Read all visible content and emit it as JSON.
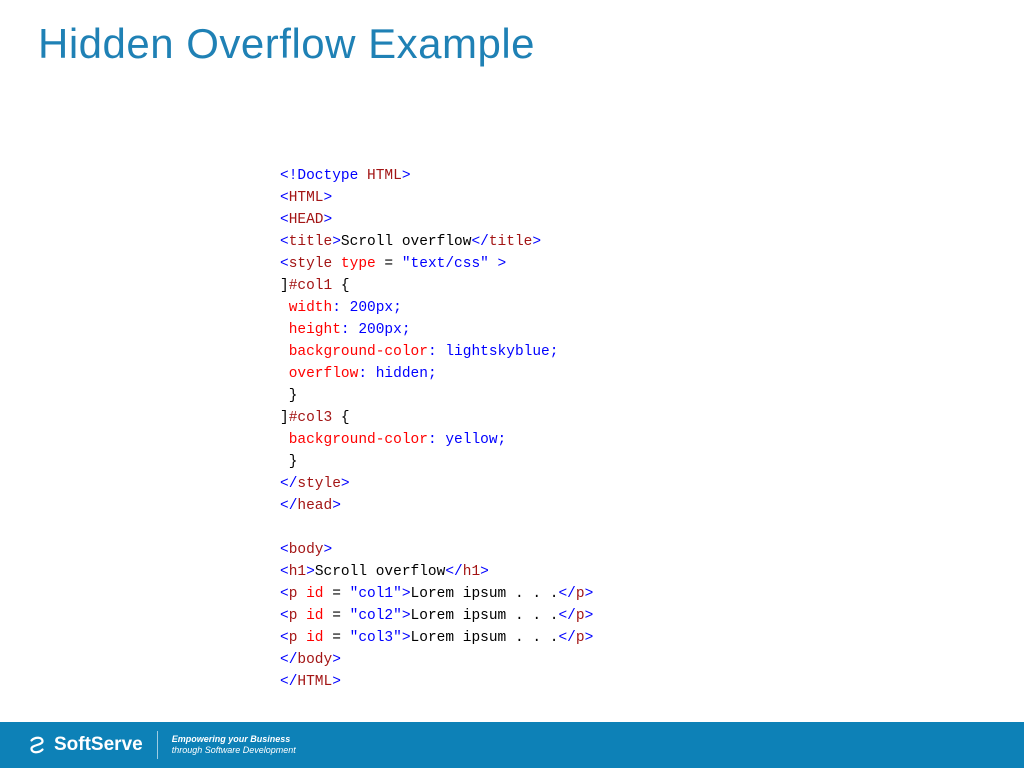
{
  "title": "Hidden Overflow Example",
  "code": {
    "l1": {
      "a": "<!Doctype ",
      "b": "HTML",
      "c": ">"
    },
    "l2": {
      "a": "<",
      "b": "HTML",
      "c": ">"
    },
    "l3": {
      "a": "<",
      "b": "HEAD",
      "c": ">"
    },
    "l4": {
      "a": "<",
      "b": "title",
      "c": ">",
      "d": "Scroll overflow",
      "e": "</",
      "f": "title",
      "g": ">"
    },
    "l5": {
      "a": "<",
      "b": "style",
      "c": " ",
      "d": "type",
      "e": " = ",
      "f": "\"text/css\"",
      "g": " >"
    },
    "l6": {
      "a": "]",
      "b": "#col1 ",
      "c": "{"
    },
    "l7": {
      "a": "width",
      "b": ": 200px;"
    },
    "l8": {
      "a": "height",
      "b": ": 200px;"
    },
    "l9": {
      "a": "background-color",
      "b": ": lightskyblue;"
    },
    "l10": {
      "a": "overflow",
      "b": ": hidden;"
    },
    "l11": "}",
    "l12": {
      "a": "]",
      "b": "#col3 ",
      "c": "{"
    },
    "l13": {
      "a": "background-color",
      "b": ": yellow;"
    },
    "l14": "}",
    "l15": {
      "a": "</",
      "b": "style",
      "c": ">"
    },
    "l16": {
      "a": "</",
      "b": "head",
      "c": ">"
    },
    "l17": {
      "a": "<",
      "b": "body",
      "c": ">"
    },
    "l18": {
      "a": "<",
      "b": "h1",
      "c": ">",
      "d": "Scroll overflow",
      "e": "</",
      "f": "h1",
      "g": ">"
    },
    "l19": {
      "a": "<",
      "b": "p",
      "c": " ",
      "d": "id",
      "e": " = ",
      "f": "\"col1\"",
      "g": ">",
      "h": "Lorem ipsum . . .",
      "i": "</",
      "j": "p",
      "k": ">"
    },
    "l20": {
      "a": "<",
      "b": "p",
      "c": " ",
      "d": "id",
      "e": " = ",
      "f": "\"col2\"",
      "g": ">",
      "h": "Lorem ipsum . . .",
      "i": "</",
      "j": "p",
      "k": ">"
    },
    "l21": {
      "a": "<",
      "b": "p",
      "c": " ",
      "d": "id",
      "e": " = ",
      "f": "\"col3\"",
      "g": ">",
      "h": "Lorem ipsum . . .",
      "i": "</",
      "j": "p",
      "k": ">"
    },
    "l22": {
      "a": "</",
      "b": "body",
      "c": ">"
    },
    "l23": {
      "a": "</",
      "b": "HTML",
      "c": ">"
    }
  },
  "footer": {
    "brand": "SoftServe",
    "tag1": "Empowering your Business",
    "tag2": "through Software Development"
  }
}
